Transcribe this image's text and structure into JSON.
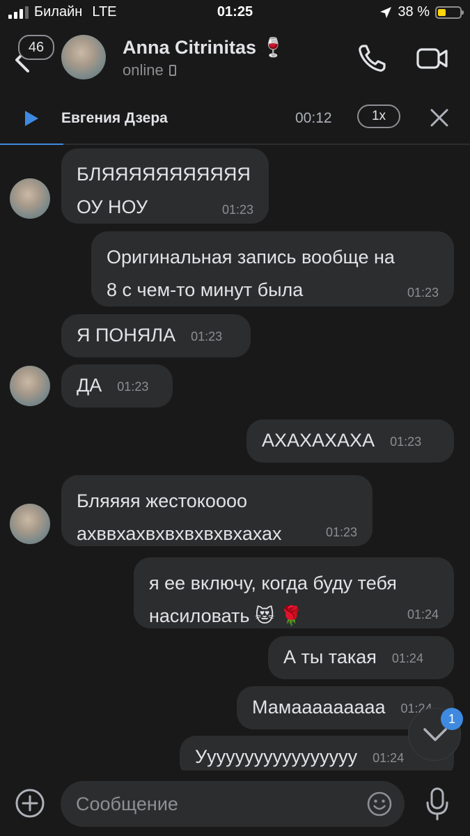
{
  "status_bar": {
    "carrier": "Билайн",
    "network": "LTE",
    "time": "01:25",
    "battery_text": "38 %",
    "battery_level": 0.38,
    "battery_color": "#ffd60a"
  },
  "header": {
    "unread_count": "46",
    "contact_name": "Anna Citrinitas 🍷",
    "contact_status": "online"
  },
  "player": {
    "title": "Евгения Дзера",
    "elapsed": "00:12",
    "speed": "1x",
    "progress": 0.135
  },
  "messages": [
    {
      "side": "in",
      "text": "БЛЯЯЯЯЯЯЯЯЯЯЯ\nОУ НОУ",
      "time": "01:23"
    },
    {
      "side": "out",
      "text": "Оригинальная запись вообще на\n8 с чем-то минут была",
      "time": "01:23"
    },
    {
      "side": "in",
      "text": "Я ПОНЯЛА",
      "time": "01:23"
    },
    {
      "side": "in",
      "text": "ДА",
      "time": "01:23"
    },
    {
      "side": "out",
      "text": "АХАХАХАХА",
      "time": "01:23"
    },
    {
      "side": "in",
      "text": "Бляяяя жестокоооо\nахввхахвхвхвхвхвхахах",
      "time": "01:23"
    },
    {
      "side": "out",
      "text": "я ее включу, когда буду тебя\nнасиловать 😻 🌹",
      "time": "01:24"
    },
    {
      "side": "out",
      "text": "А ты такая",
      "time": "01:24"
    },
    {
      "side": "out",
      "text": "Мамааааааааа",
      "time": "01:24"
    },
    {
      "side": "out",
      "text": "Ууууууууууууууууу",
      "time": "01:24"
    }
  ],
  "scroll_down": {
    "new_count": "1"
  },
  "composer": {
    "placeholder": "Сообщение"
  },
  "colors": {
    "accent": "#3f8ae0",
    "bubble": "#2c2d2e",
    "background": "#19191a"
  }
}
